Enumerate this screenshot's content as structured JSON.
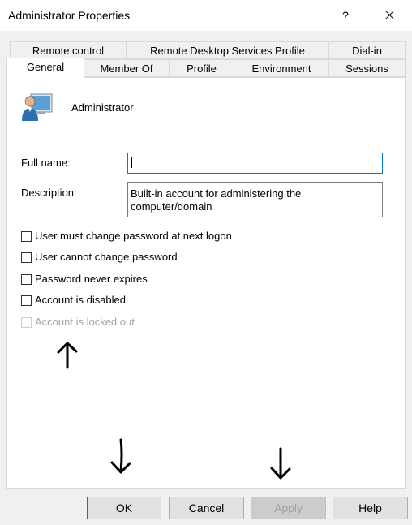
{
  "window": {
    "title": "Administrator Properties",
    "help": "?"
  },
  "tabs": {
    "row_back": [
      "Remote control",
      "Remote Desktop Services Profile",
      "Dial-in"
    ],
    "row_front": [
      "General",
      "Member Of",
      "Profile",
      "Environment",
      "Sessions"
    ],
    "active": "General"
  },
  "general": {
    "user_icon": "user-icon",
    "user_name": "Administrator",
    "full_name_label": "Full name:",
    "full_name_value": "",
    "description_label": "Description:",
    "description_value": "Built-in account for administering the computer/domain"
  },
  "options": [
    {
      "label": "User must change password at next logon",
      "checked": false,
      "enabled": true
    },
    {
      "label": "User cannot change password",
      "checked": false,
      "enabled": true
    },
    {
      "label": "Password never expires",
      "checked": false,
      "enabled": true
    },
    {
      "label": "Account is disabled",
      "checked": false,
      "enabled": true
    },
    {
      "label": "Account is locked out",
      "checked": false,
      "enabled": false
    }
  ],
  "buttons": {
    "ok": "OK",
    "cancel": "Cancel",
    "apply": "Apply",
    "help": "Help",
    "apply_enabled": false
  },
  "annotations": [
    "arrow-up-icon",
    "arrow-down-icon",
    "arrow-down-icon"
  ]
}
